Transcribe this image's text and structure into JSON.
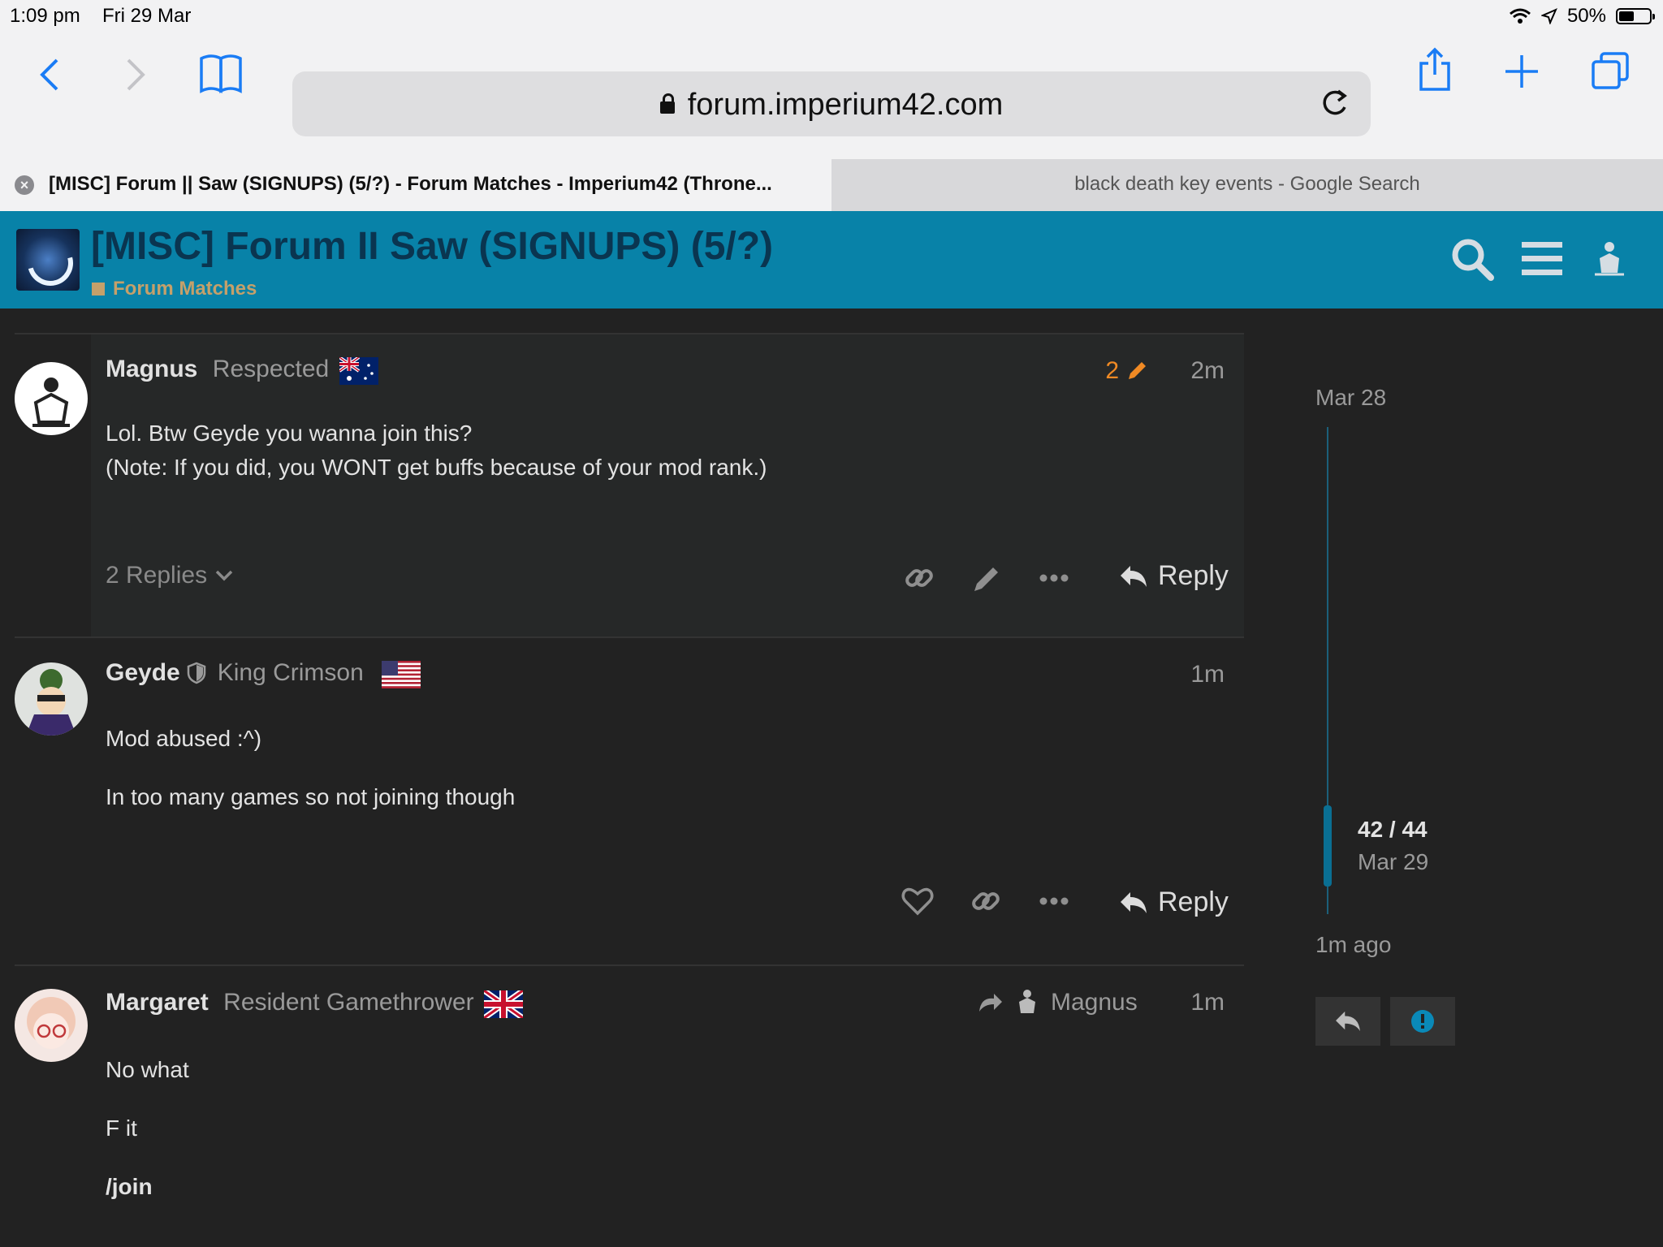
{
  "status_bar": {
    "time": "1:09 pm",
    "date": "Fri 29 Mar",
    "battery": "50%"
  },
  "browser": {
    "url": "forum.imperium42.com",
    "tabs": [
      {
        "title": "[MISC] Forum || Saw (SIGNUPS) (5/?) - Forum Matches - Imperium42 (Throne...",
        "active": true
      },
      {
        "title": "black death key events - Google Search",
        "active": false
      }
    ]
  },
  "forum_header": {
    "title": "[MISC] Forum II Saw (SIGNUPS) (5/?)",
    "category": "Forum Matches",
    "colors": {
      "bar": "#0882a8",
      "title": "#0a3550",
      "category": "#c5a06a"
    }
  },
  "posts": [
    {
      "author": "Magnus",
      "user_title": "Respected",
      "flag": "australia",
      "edits": "2",
      "time": "2m",
      "lines": [
        "Lol. Btw Geyde you wanna join this?",
        "(Note: If you did, you WONT get buffs because of your mod rank.)"
      ],
      "replies_label": "2 Replies",
      "reply_label": "Reply"
    },
    {
      "author": "Geyde",
      "user_title": "King Crimson",
      "flag": "usa",
      "time": "1m",
      "paragraphs": [
        "Mod abused :^)",
        "In too many games so not joining though"
      ],
      "reply_label": "Reply"
    },
    {
      "author": "Margaret",
      "user_title": "Resident Gamethrower",
      "flag": "uk",
      "reply_to": "Magnus",
      "time": "1m",
      "paragraphs": [
        "No what",
        "F it",
        "/join"
      ]
    }
  ],
  "timeline": {
    "start_date": "Mar 28",
    "position": "42 / 44",
    "position_date": "Mar 29",
    "end_label": "1m ago"
  }
}
